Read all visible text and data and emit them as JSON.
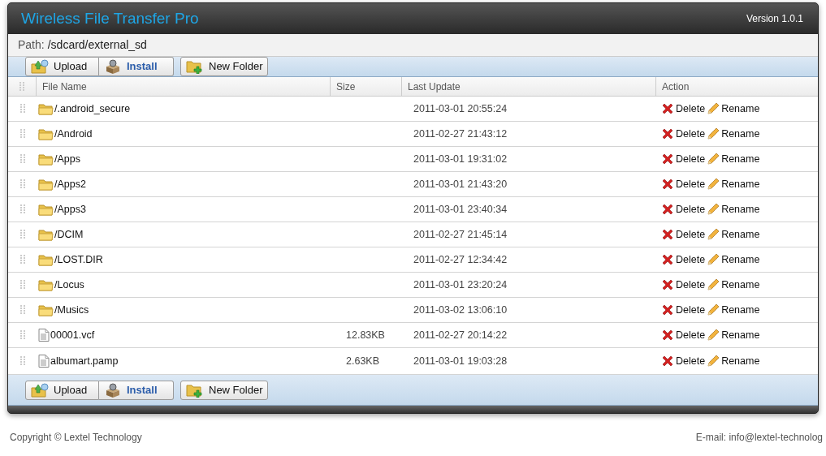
{
  "window": {
    "title": "Wireless File Transfer Pro",
    "version": "Version 1.0.1"
  },
  "path": {
    "label": "Path:",
    "value": "/sdcard/external_sd"
  },
  "toolbar": [
    {
      "kind": "upload",
      "label": "Upload"
    },
    {
      "kind": "install",
      "label": "Install"
    },
    {
      "kind": "new_folder",
      "label": "New Folder"
    }
  ],
  "table": {
    "columns": [
      "File Name",
      "Size",
      "Last Update",
      "Action"
    ],
    "rows": [
      {
        "kind": "folder",
        "name": "/.android_secure",
        "updated": "2011-03-01 20:55:24",
        "actions": [
          "Delete",
          "Rename"
        ]
      },
      {
        "kind": "folder",
        "name": "/Android",
        "updated": "2011-02-27 21:43:12",
        "actions": [
          "Delete",
          "Rename"
        ]
      },
      {
        "kind": "folder",
        "name": "/Apps",
        "updated": "2011-03-01 19:31:02",
        "actions": [
          "Delete",
          "Rename"
        ]
      },
      {
        "kind": "folder",
        "name": "/Apps2",
        "updated": "2011-03-01 21:43:20",
        "actions": [
          "Delete",
          "Rename"
        ]
      },
      {
        "kind": "folder",
        "name": "/Apps3",
        "updated": "2011-03-01 23:40:34",
        "actions": [
          "Delete",
          "Rename"
        ]
      },
      {
        "kind": "folder",
        "name": "/DCIM",
        "updated": "2011-02-27 21:45:14",
        "actions": [
          "Delete",
          "Rename"
        ]
      },
      {
        "kind": "folder",
        "name": "/LOST.DIR",
        "updated": "2011-02-27 12:34:42",
        "actions": [
          "Delete",
          "Rename"
        ]
      },
      {
        "kind": "folder",
        "name": "/Locus",
        "updated": "2011-03-01 23:20:24",
        "actions": [
          "Delete",
          "Rename"
        ]
      },
      {
        "kind": "folder",
        "name": "/Musics",
        "updated": "2011-03-02 13:06:10",
        "actions": [
          "Delete",
          "Rename"
        ]
      },
      {
        "kind": "file",
        "name": "00001.vcf",
        "size": "12.83KB",
        "updated": "2011-02-27 20:14:22",
        "actions": [
          "Delete",
          "Rename"
        ]
      },
      {
        "kind": "file",
        "name": "albumart.pamp",
        "size": "2.63KB",
        "updated": "2011-03-01 19:03:28",
        "actions": [
          "Delete",
          "Rename"
        ]
      }
    ]
  },
  "bottom_toolbar": [
    {
      "kind": "upload",
      "label": "Upload"
    },
    {
      "kind": "install",
      "label": "Install"
    },
    {
      "kind": "new_folder",
      "label": "New Folder"
    }
  ],
  "footer": {
    "copyright": "Copyright © Lextel Technology",
    "email": "E-mail: info@lextel-technolog"
  }
}
